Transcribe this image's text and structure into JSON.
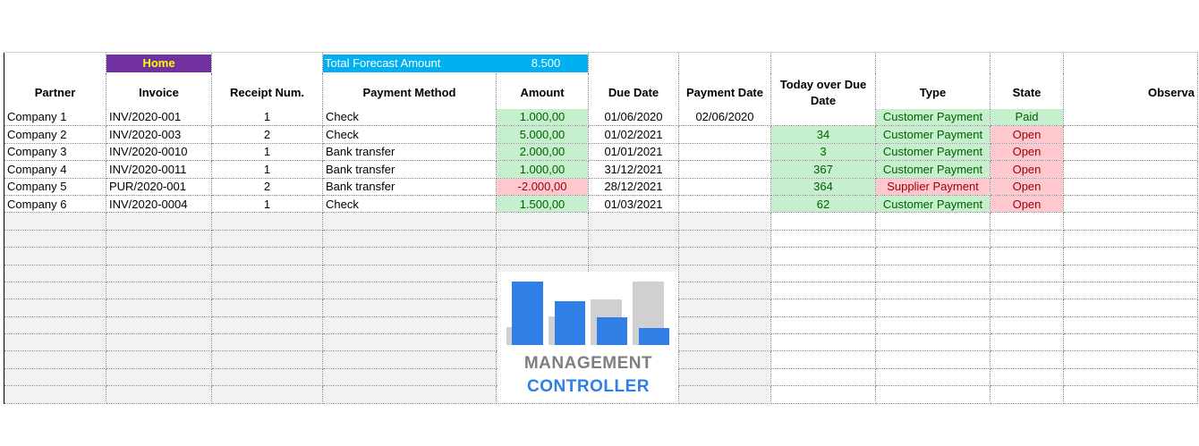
{
  "buttons": {
    "home_label": "Home"
  },
  "forecast": {
    "label": "Total Forecast Amount",
    "value": "8.500"
  },
  "headers": [
    "Partner",
    "Invoice",
    "Receipt Num.",
    "Payment Method",
    "Amount",
    "Due Date",
    "Payment Date",
    "Today over Due Date",
    "Type",
    "State",
    "Observa"
  ],
  "rows": [
    {
      "partner": "Company 1",
      "invoice": "INV/2020-001",
      "receipt": "1",
      "method": "Check",
      "amount": "1.000,00",
      "amount_status": "green",
      "due": "01/06/2020",
      "paid": "02/06/2020",
      "over": "",
      "over_status": "none",
      "type": "Customer Payment",
      "type_status": "green",
      "state": "Paid",
      "state_status": "green"
    },
    {
      "partner": "Company 2",
      "invoice": "INV/2020-003",
      "receipt": "2",
      "method": "Check",
      "amount": "5.000,00",
      "amount_status": "green",
      "due": "01/02/2021",
      "paid": "",
      "over": "34",
      "over_status": "green",
      "type": "Customer Payment",
      "type_status": "green",
      "state": "Open",
      "state_status": "red"
    },
    {
      "partner": "Company 3",
      "invoice": "INV/2020-0010",
      "receipt": "1",
      "method": "Bank transfer",
      "amount": "2.000,00",
      "amount_status": "green",
      "due": "01/01/2021",
      "paid": "",
      "over": "3",
      "over_status": "green",
      "type": "Customer Payment",
      "type_status": "green",
      "state": "Open",
      "state_status": "red"
    },
    {
      "partner": "Company 4",
      "invoice": "INV/2020-0011",
      "receipt": "1",
      "method": "Bank transfer",
      "amount": "1.000,00",
      "amount_status": "green",
      "due": "31/12/2021",
      "paid": "",
      "over": "367",
      "over_status": "green",
      "type": "Customer Payment",
      "type_status": "green",
      "state": "Open",
      "state_status": "red"
    },
    {
      "partner": "Company 5",
      "invoice": "PUR/2020-001",
      "receipt": "2",
      "method": "Bank transfer",
      "amount": "-2.000,00",
      "amount_status": "red",
      "due": "28/12/2021",
      "paid": "",
      "over": "364",
      "over_status": "green",
      "type": "Supplier Payment",
      "type_status": "red",
      "state": "Open",
      "state_status": "red"
    },
    {
      "partner": "Company 6",
      "invoice": "INV/2020-0004",
      "receipt": "1",
      "method": "Check",
      "amount": "1.500,00",
      "amount_status": "green",
      "due": "01/03/2021",
      "paid": "",
      "over": "62",
      "over_status": "green",
      "type": "Customer Payment",
      "type_status": "green",
      "state": "Open",
      "state_status": "red"
    }
  ],
  "empty_row_count": 11,
  "logo": {
    "line1": "MANAGEMENT",
    "line2": "CONTROLLER"
  },
  "colors": {
    "home_bg": "#7030a0",
    "home_text": "#ffff00",
    "forecast_bg": "#00b0f0",
    "good_bg": "#c6efce",
    "good_text": "#006100",
    "bad_bg": "#ffc7ce",
    "bad_text": "#9c0006",
    "logo_blue": "#2f7fe6",
    "logo_grey": "#7f7f7f"
  }
}
